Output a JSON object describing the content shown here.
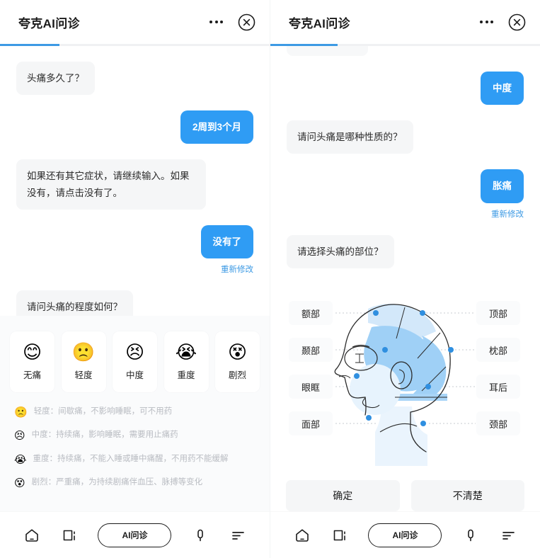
{
  "app": {
    "title": "夸克AI问诊",
    "accent_color": "#2f9cf4",
    "progress_color": "#3d9ae4",
    "bot_bubble_color": "#f5f6f7"
  },
  "header": {
    "title": "夸克AI问诊",
    "more_icon": "more-dots-icon",
    "close_icon": "close-circle-icon"
  },
  "left": {
    "progress_percent": 22,
    "messages": [
      {
        "from": "bot",
        "text": "头痛多久了？"
      },
      {
        "from": "user",
        "text": "2周到3个月"
      },
      {
        "from": "bot",
        "text": "如果还有其它症状，请继续输入。如果没有，请点击没有了。"
      },
      {
        "from": "user",
        "text": "没有了",
        "redo": "重新修改"
      },
      {
        "from": "bot",
        "text": "请问头痛的程度如何？"
      }
    ],
    "severity": {
      "options": [
        {
          "label": "无痛",
          "emoji": "😊"
        },
        {
          "label": "轻度",
          "emoji": "🙁"
        },
        {
          "label": "中度",
          "emoji": "😣"
        },
        {
          "label": "重度",
          "emoji": "😭"
        },
        {
          "label": "剧烈",
          "emoji": "😵"
        }
      ],
      "legend": [
        {
          "emoji": "🙁",
          "text": "轻度：间歇痛，不影响睡眠，可不用药"
        },
        {
          "emoji": "😣",
          "text": "中度：持续痛，影响睡眠，需要用止痛药"
        },
        {
          "emoji": "😭",
          "text": "重度：持续痛，不能入睡或睡中痛醒，不用药不能缓解"
        },
        {
          "emoji": "😵",
          "text": "剧烈：严重痛，为持续剧痛伴血压、脉搏等变化"
        }
      ]
    }
  },
  "right": {
    "progress_percent": 25,
    "messages": [
      {
        "from": "user",
        "text": "中度"
      },
      {
        "from": "bot",
        "text": "请问头痛是哪种性质的？"
      },
      {
        "from": "user",
        "text": "胀痛",
        "redo": "重新修改"
      },
      {
        "from": "bot",
        "text": "请选择头痛的部位？"
      }
    ],
    "locator": {
      "labels_left": [
        "额部",
        "颞部",
        "眼眶",
        "面部"
      ],
      "labels_right": [
        "顶部",
        "枕部",
        "耳后",
        "颈部"
      ],
      "region_color": "#bfdcf7",
      "dot_color": "#2f8fe0"
    },
    "actions": {
      "confirm": "确定",
      "unsure": "不清楚"
    }
  },
  "navbar": {
    "home_icon": "home-icon",
    "card_icon": "card-icon",
    "pill_label": "AI问诊",
    "mic_icon": "microphone-icon",
    "menu_icon": "menu-lines-icon"
  }
}
